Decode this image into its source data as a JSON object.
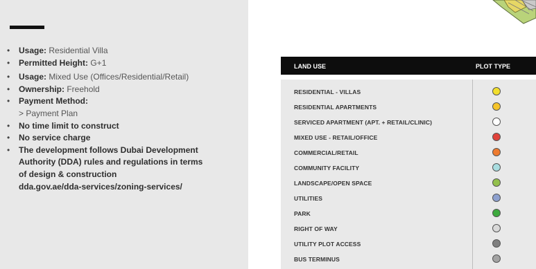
{
  "left": {
    "bullets": [
      {
        "bold": "Usage:",
        "text": " Residential Villa"
      },
      {
        "bold": "Permitted Height:",
        "text": " G+1"
      },
      {
        "bold": "Usage:",
        "text": " Mixed Use (Offices/Residential/Retail)"
      },
      {
        "bold": "Ownership:",
        "text": " Freehold"
      },
      {
        "bold": "Payment Method:",
        "text": ""
      },
      {
        "sub": "> Payment Plan"
      },
      {
        "bold": "No time limit to construct"
      },
      {
        "bold": "No service charge"
      },
      {
        "bold": "The development follows Dubai Development"
      },
      {
        "cont": "Authority (DDA) rules and regulations in terms"
      },
      {
        "cont": "of design & construction"
      },
      {
        "cont": "dda.gov.ae/dda-services/zoning-services/"
      }
    ]
  },
  "table": {
    "header_land_use": "LAND USE",
    "header_plot_type": "PLOT TYPE",
    "rows": [
      {
        "label": "RESIDENTIAL - VILLAS",
        "color": "#f2df2c"
      },
      {
        "label": "RESIDENTIAL APARTMENTS",
        "color": "#f5c42a"
      },
      {
        "label": "SERVICED APARTMENT (APT. + RETAIL/CLINIC)",
        "color": "#ffffff"
      },
      {
        "label": "MIXED USE - RETAIL/OFFICE",
        "color": "#e0423b"
      },
      {
        "label": "COMMERCIAL/RETAIL",
        "color": "#ee7b2e"
      },
      {
        "label": "COMMUNITY FACILITY",
        "color": "#a9dde0"
      },
      {
        "label": "LANDSCAPE/OPEN SPACE",
        "color": "#93c04c"
      },
      {
        "label": "UTILITIES",
        "color": "#8da0cf"
      },
      {
        "label": "PARK",
        "color": "#3daa3e"
      },
      {
        "label": "RIGHT OF WAY",
        "color": "#d9d9d9"
      },
      {
        "label": "UTILITY PLOT ACCESS",
        "color": "#7f7f7f"
      },
      {
        "label": "BUS TERMINUS",
        "color": "#a3a3a3"
      }
    ]
  }
}
